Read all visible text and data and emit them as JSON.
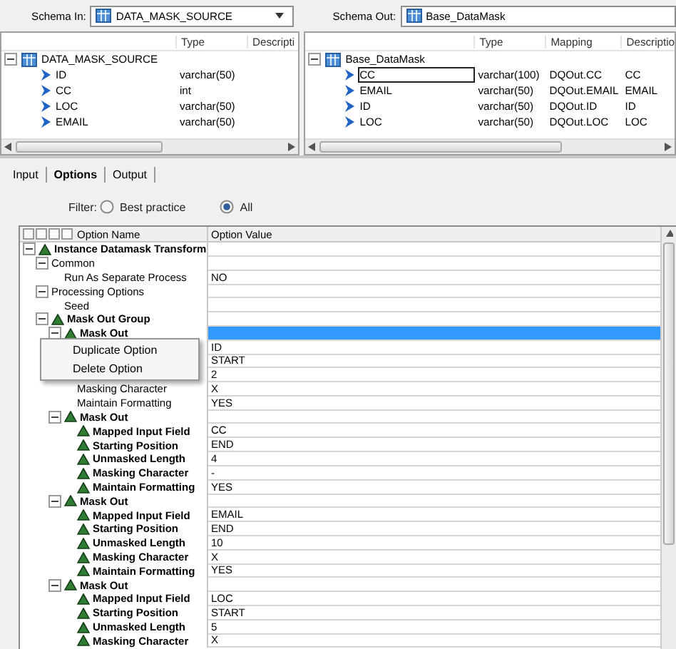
{
  "schema_in": {
    "label": "Schema In:",
    "value": "DATA_MASK_SOURCE",
    "columns": [
      "Type",
      "Descripti"
    ],
    "tree": {
      "name": "DATA_MASK_SOURCE",
      "expanded": true,
      "children": [
        {
          "name": "ID",
          "type": "varchar(50)"
        },
        {
          "name": "CC",
          "type": "int"
        },
        {
          "name": "LOC",
          "type": "varchar(50)"
        },
        {
          "name": "EMAIL",
          "type": "varchar(50)"
        }
      ]
    }
  },
  "schema_out": {
    "label": "Schema Out:",
    "value": "Base_DataMask",
    "columns": [
      "Type",
      "Mapping",
      "Descriptio"
    ],
    "tree": {
      "name": "Base_DataMask",
      "expanded": true,
      "children": [
        {
          "name": "CC",
          "type": "varchar(100)",
          "mapping": "DQOut.CC",
          "description": "CC",
          "selected": true
        },
        {
          "name": "EMAIL",
          "type": "varchar(50)",
          "mapping": "DQOut.EMAIL",
          "description": "EMAIL",
          "selected": false
        },
        {
          "name": "ID",
          "type": "varchar(50)",
          "mapping": "DQOut.ID",
          "description": "ID",
          "selected": false
        },
        {
          "name": "LOC",
          "type": "varchar(50)",
          "mapping": "DQOut.LOC",
          "description": "LOC",
          "selected": false
        }
      ]
    }
  },
  "tabs": [
    {
      "label": "Input",
      "selected": false
    },
    {
      "label": "Options",
      "selected": true
    },
    {
      "label": "Output",
      "selected": false
    }
  ],
  "filter": {
    "label": "Filter:",
    "options": [
      {
        "label": "Best practice",
        "selected": false
      },
      {
        "label": "All",
        "selected": true
      }
    ]
  },
  "options_table": {
    "columns": [
      "Option Name",
      "Option Value"
    ],
    "rows": [
      {
        "name": "Instance Datamask Transform",
        "required": true,
        "expanded": true,
        "selected": false,
        "children": [
          {
            "name": "Common",
            "expanded": true,
            "selected": false,
            "children": [
              {
                "name": "Run As Separate Process",
                "value": "NO",
                "selected": false
              }
            ]
          },
          {
            "name": "Processing Options",
            "expanded": true,
            "selected": false,
            "children": [
              {
                "name": "Seed",
                "selected": false
              }
            ]
          },
          {
            "name": "Mask Out Group",
            "required": true,
            "expanded": true,
            "selected": false,
            "children": [
              {
                "name": "Mask Out",
                "required": true,
                "expanded": true,
                "selected": true,
                "children": [
                  {
                    "value": "ID",
                    "selected": false
                  },
                  {
                    "value": "START",
                    "selected": false
                  },
                  {
                    "value": "2",
                    "selected": false
                  },
                  {
                    "name": "Masking Character",
                    "value": "X",
                    "selected": false
                  },
                  {
                    "name": "Maintain Formatting",
                    "value": "YES",
                    "selected": false
                  }
                ]
              },
              {
                "name": "Mask Out",
                "required": true,
                "expanded": true,
                "selected": false,
                "children": [
                  {
                    "name": "Mapped Input Field",
                    "required": true,
                    "value": "CC",
                    "selected": false
                  },
                  {
                    "name": "Starting Position",
                    "required": true,
                    "value": "END",
                    "selected": false
                  },
                  {
                    "name": "Unmasked Length",
                    "required": true,
                    "value": "4",
                    "selected": false
                  },
                  {
                    "name": "Masking Character",
                    "required": true,
                    "value": "-",
                    "selected": false
                  },
                  {
                    "name": "Maintain Formatting",
                    "required": true,
                    "value": "YES",
                    "selected": false
                  }
                ]
              },
              {
                "name": "Mask Out",
                "required": true,
                "expanded": true,
                "selected": false,
                "children": [
                  {
                    "name": "Mapped Input Field",
                    "required": true,
                    "value": "EMAIL",
                    "selected": false
                  },
                  {
                    "name": "Starting Position",
                    "required": true,
                    "value": "END",
                    "selected": false
                  },
                  {
                    "name": "Unmasked Length",
                    "required": true,
                    "value": "10",
                    "selected": false
                  },
                  {
                    "name": "Masking Character",
                    "required": true,
                    "value": "X",
                    "selected": false
                  },
                  {
                    "name": "Maintain Formatting",
                    "required": true,
                    "value": "YES",
                    "selected": false
                  }
                ]
              },
              {
                "name": "Mask Out",
                "required": true,
                "expanded": true,
                "selected": false,
                "children": [
                  {
                    "name": "Mapped Input Field",
                    "required": true,
                    "value": "LOC",
                    "selected": false
                  },
                  {
                    "name": "Starting Position",
                    "required": true,
                    "value": "START",
                    "selected": false
                  },
                  {
                    "name": "Unmasked Length",
                    "required": true,
                    "value": "5",
                    "selected": false
                  },
                  {
                    "name": "Masking Character",
                    "required": true,
                    "value": "X",
                    "selected": false
                  }
                ]
              }
            ]
          }
        ]
      }
    ]
  },
  "context_menu": {
    "items": [
      "Duplicate Option",
      "Delete Option"
    ]
  }
}
